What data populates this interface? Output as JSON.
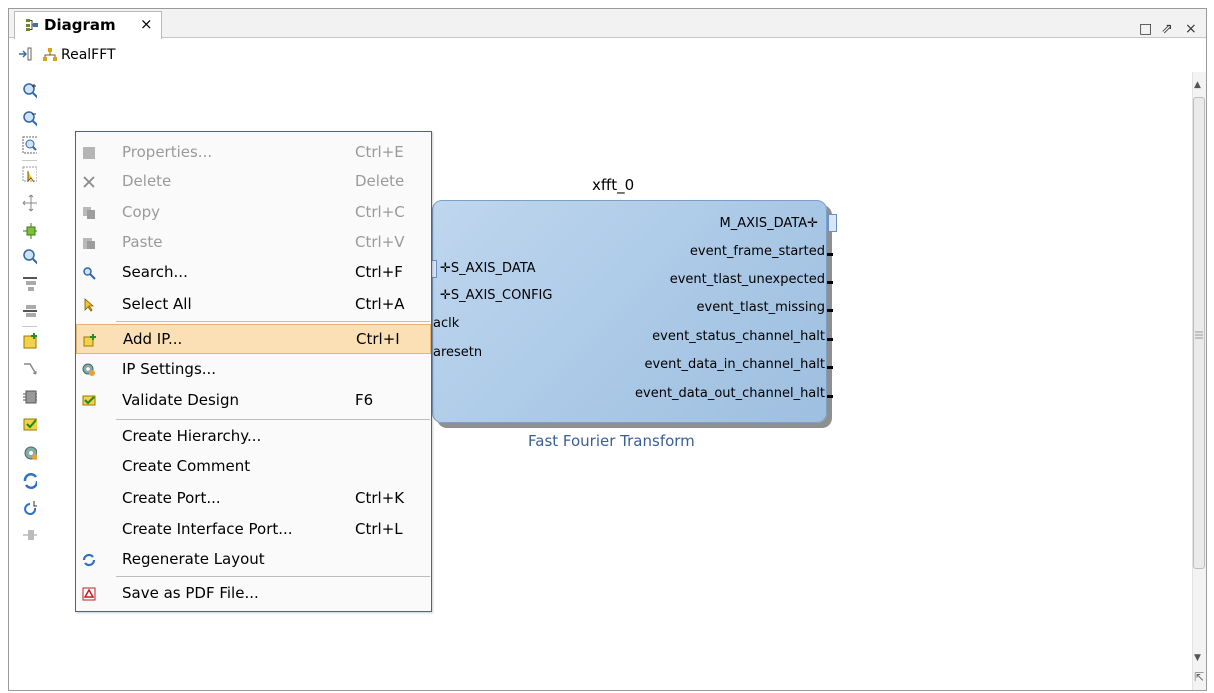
{
  "panel": {
    "tab_title": "Diagram",
    "tab_close": "×",
    "window_buttons": [
      "□",
      "⇗",
      "×"
    ]
  },
  "breadcrumb": {
    "label": "RealFFT"
  },
  "menu": {
    "items": [
      {
        "label": "Properties...",
        "shortcut": "Ctrl+E"
      },
      {
        "label": "Delete",
        "shortcut": "Delete"
      },
      {
        "label": "Copy",
        "shortcut": "Ctrl+C"
      },
      {
        "label": "Paste",
        "shortcut": "Ctrl+V"
      },
      {
        "label": "Search...",
        "shortcut": "Ctrl+F"
      },
      {
        "label": "Select All",
        "shortcut": "Ctrl+A"
      },
      {
        "label": "Add IP...",
        "shortcut": "Ctrl+I"
      },
      {
        "label": "IP Settings...",
        "shortcut": ""
      },
      {
        "label": "Validate Design",
        "shortcut": "F6"
      },
      {
        "label": "Create Hierarchy...",
        "shortcut": ""
      },
      {
        "label": "Create Comment",
        "shortcut": ""
      },
      {
        "label": "Create Port...",
        "shortcut": "Ctrl+K"
      },
      {
        "label": "Create Interface Port...",
        "shortcut": "Ctrl+L"
      },
      {
        "label": "Regenerate Layout",
        "shortcut": ""
      },
      {
        "label": "Save as PDF File...",
        "shortcut": ""
      }
    ]
  },
  "ip": {
    "instance": "xfft_0",
    "title": "Fast Fourier Transform",
    "inputs": [
      "S_AXIS_DATA",
      "S_AXIS_CONFIG",
      "aclk",
      "aresetn"
    ],
    "outputs": [
      "M_AXIS_DATA",
      "event_frame_started",
      "event_tlast_unexpected",
      "event_tlast_missing",
      "event_status_channel_halt",
      "event_data_in_channel_halt",
      "event_data_out_channel_halt"
    ]
  },
  "colors": {
    "accent": "#fbe0b5",
    "block": "#a9c8e6",
    "menu_border": "#4f5ba8"
  }
}
